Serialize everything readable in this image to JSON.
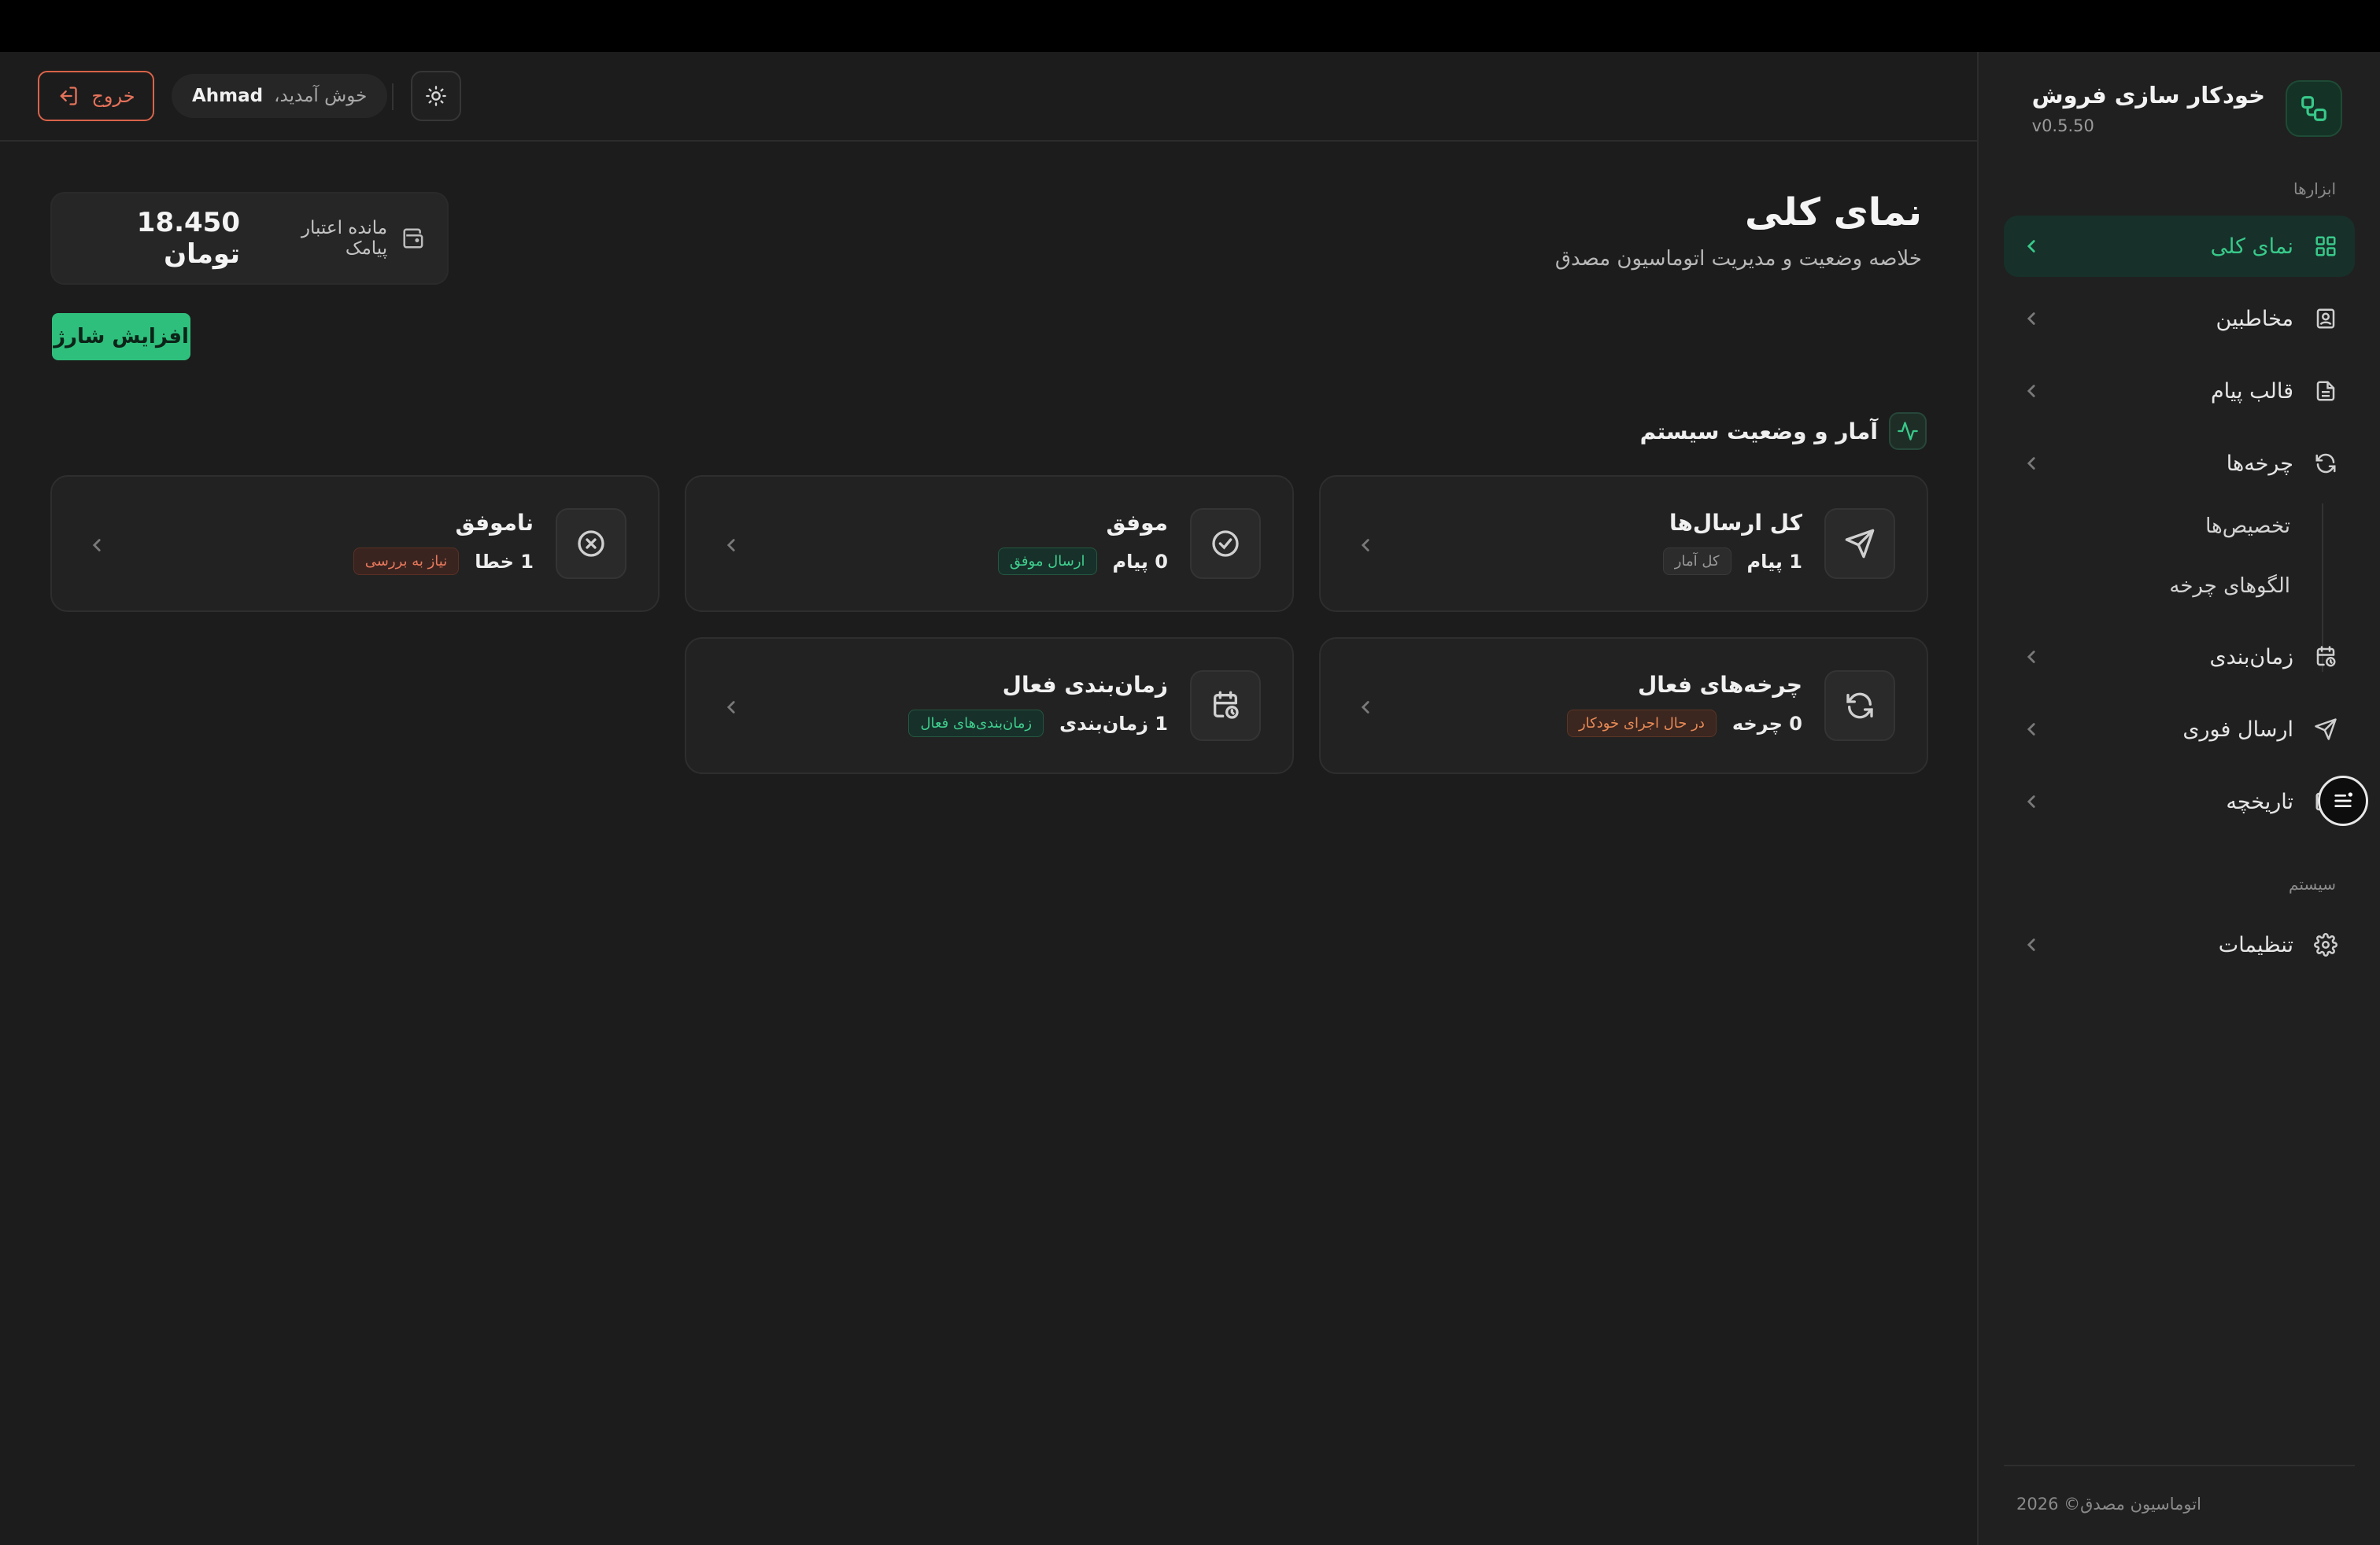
{
  "app": {
    "title": "خودکار سازی فروش",
    "version": "v0.5.50"
  },
  "sidebar": {
    "section_tools": "ابزارها",
    "section_system": "سیستم",
    "items": [
      {
        "label": "نمای کلی",
        "icon": "grid-icon",
        "active": true
      },
      {
        "label": "مخاطبین",
        "icon": "contact-icon",
        "active": false
      },
      {
        "label": "قالب پیام",
        "icon": "document-icon",
        "active": false
      },
      {
        "label": "چرخه‌ها",
        "icon": "refresh-icon",
        "active": false
      },
      {
        "label": "زمان‌بندی",
        "icon": "calendar-clock-icon",
        "active": false
      },
      {
        "label": "ارسال فوری",
        "icon": "send-icon",
        "active": false
      },
      {
        "label": "تاریخچه",
        "icon": "history-icon",
        "active": false
      },
      {
        "label": "تنظیمات",
        "icon": "gear-icon",
        "active": false
      }
    ],
    "sub_items": [
      "تخصیص‌ها",
      "الگوهای چرخه"
    ],
    "footer": "اتوماسیون مصدق© 2026"
  },
  "header": {
    "logout_label": "خروج",
    "welcome_greeting": "خوش آمدید،",
    "user_name": "Ahmad"
  },
  "main": {
    "title": "نمای کلی",
    "subtitle": "خلاصه وضعیت و مدیریت اتوماسیون مصدق",
    "credit": {
      "label": "مانده اعتبار پیامک",
      "value": "18.450 تومان"
    },
    "charge_button": "افزایش شارژ",
    "stats_title": "آمار و وضعیت سیستم",
    "cards": [
      {
        "title": "کل ارسال‌ها",
        "value": "1 پیام",
        "badge": "کل آمار",
        "badge_style": "gray",
        "icon": "send-icon"
      },
      {
        "title": "موفق",
        "value": "0 پیام",
        "badge": "ارسال موفق",
        "badge_style": "green",
        "icon": "check-circle-icon"
      },
      {
        "title": "ناموفق",
        "value": "1 خطا",
        "badge": "نیاز به بررسی",
        "badge_style": "red",
        "icon": "x-circle-icon"
      },
      {
        "title": "چرخه‌های فعال",
        "value": "0 چرخه",
        "badge": "در حال اجرای خودکار",
        "badge_style": "orange",
        "icon": "refresh-icon"
      },
      {
        "title": "زمان‌بندی فعال",
        "value": "1 زمان‌بندی",
        "badge": "زمان‌بندی‌های فعال",
        "badge_style": "green",
        "icon": "calendar-clock-icon"
      }
    ]
  },
  "colors": {
    "accent": "#2fbf7c",
    "danger": "#d9634a",
    "background": "#1c1c1c",
    "sidebar": "#202020"
  }
}
